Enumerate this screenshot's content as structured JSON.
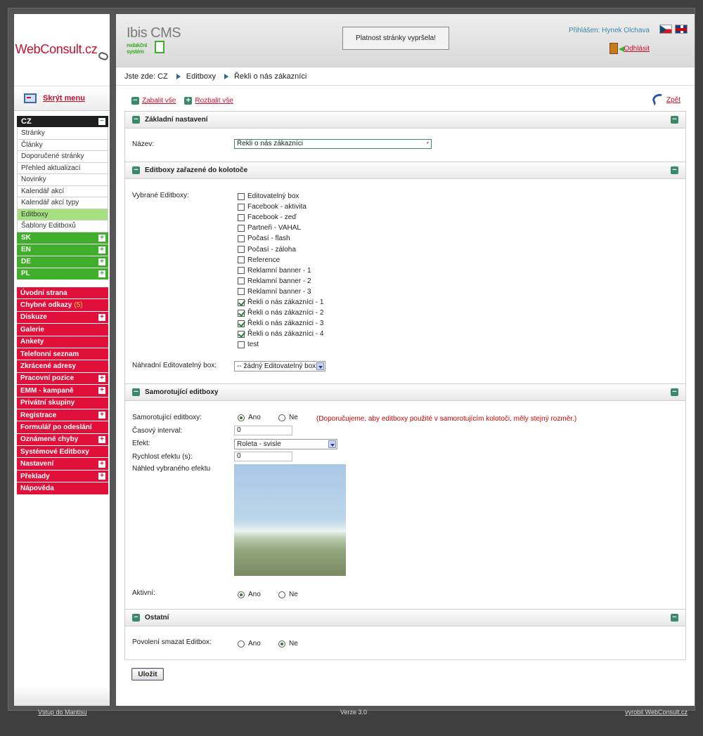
{
  "sidebar": {
    "logo": "WebConsult.cz",
    "hide_menu": "Skrýt menu",
    "lang_cz": {
      "label": "CZ",
      "items": [
        "Stránky",
        "Články",
        "Doporučené stránky",
        "Přehled aktualizací",
        "Novinky",
        "Kalendář akcí",
        "Kalendář akcí typy",
        "Editboxy",
        "Šablony Editboxů"
      ],
      "active_index": 7
    },
    "langs_other": [
      "SK",
      "EN",
      "DE",
      "PL"
    ],
    "menu": [
      {
        "label": "Úvodní strana",
        "plus": false
      },
      {
        "label": "Chybné odkazy",
        "count": "(5)",
        "plus": false
      },
      {
        "label": "Diskuze",
        "plus": true
      },
      {
        "label": "Galerie",
        "plus": false
      },
      {
        "label": "Ankety",
        "plus": false
      },
      {
        "label": "Telefonní seznam",
        "plus": false
      },
      {
        "label": "Zkrácené adresy",
        "plus": false
      },
      {
        "label": "Pracovní pozice",
        "plus": true
      },
      {
        "label": "EMM - kampaně",
        "plus": true
      },
      {
        "label": "Privátní skupiny",
        "plus": false
      },
      {
        "label": "Registrace",
        "plus": true
      },
      {
        "label": "Formulář po odeslání",
        "plus": false
      },
      {
        "label": "Oznámené chyby",
        "plus": true
      },
      {
        "label": "Systémové Editboxy",
        "plus": false
      },
      {
        "label": "Nastavení",
        "plus": true
      },
      {
        "label": "Překlady",
        "plus": true
      },
      {
        "label": "Nápověda",
        "plus": false
      }
    ]
  },
  "header": {
    "app_name": "Ibis CMS",
    "app_sub1": "redakční",
    "app_sub2": "systém",
    "expired": "Platnost stránky vypršela!",
    "logged_in": "Přihlášen: Hynek Olchava",
    "logout": "Odhlásit"
  },
  "breadcrumb": {
    "label": "Jste zde:",
    "items": [
      "CZ",
      "Editboxy",
      "Řekli o nás zákazníci"
    ]
  },
  "toolbar": {
    "collapse": "Zabalit vše",
    "expand": "Rozbalit vše",
    "back": "Zpět"
  },
  "sections": {
    "basic": {
      "title": "Základní nastavení",
      "name_label": "Název:",
      "name_value": "Řekli o nás zákazníci",
      "req": "*"
    },
    "carousel": {
      "title": "Editboxy zařazené do kolotoče",
      "selected_label": "Vybrané Editboxy:",
      "items": [
        {
          "label": "Editovatelný box",
          "checked": false
        },
        {
          "label": "Facebook - aktivita",
          "checked": false
        },
        {
          "label": "Facebook - zeď",
          "checked": false
        },
        {
          "label": "Partneři - VAHAL",
          "checked": false
        },
        {
          "label": "Počasí - flash",
          "checked": false
        },
        {
          "label": "Počasí - záloha",
          "checked": false
        },
        {
          "label": "Reference",
          "checked": false
        },
        {
          "label": "Reklamní banner - 1",
          "checked": false
        },
        {
          "label": "Reklamní banner - 2",
          "checked": false
        },
        {
          "label": "Reklamní banner - 3",
          "checked": false
        },
        {
          "label": "Řekli o nás zákazníci - 1",
          "checked": true
        },
        {
          "label": "Řekli o nás zákazníci - 2",
          "checked": true
        },
        {
          "label": "Řekli o nás zákazníci - 3",
          "checked": true
        },
        {
          "label": "Řekli o nás zákazníci - 4",
          "checked": true
        },
        {
          "label": "test",
          "checked": false
        }
      ],
      "fallback_label": "Náhradní Editovatelný box:",
      "fallback_value": "-- žádný Editovatelný box --"
    },
    "rotating": {
      "title": "Samorotující editboxy",
      "rot_label": "Samorotující editboxy:",
      "yes": "Ano",
      "no": "Ne",
      "warning": "(Doporučujeme, aby editboxy použité v samorotujícím kolotoči, měly stejný rozměr.)",
      "interval_label": "Časový interval:",
      "interval_value": "0",
      "effect_label": "Efekt:",
      "effect_value": "Roleta - svisle",
      "speed_label": "Rychlost efektu (s):",
      "speed_value": "0",
      "preview_label": "Náhled vybraného efektu",
      "active_label": "Aktivní:"
    },
    "other": {
      "title": "Ostatní",
      "delete_label": "Povolení smazat Editbox:"
    }
  },
  "save": "Uložit",
  "footer": {
    "left": "Vstup do Mantisu",
    "center": "Verze 3.0",
    "right": "vyrobil WebConsult.cz"
  }
}
